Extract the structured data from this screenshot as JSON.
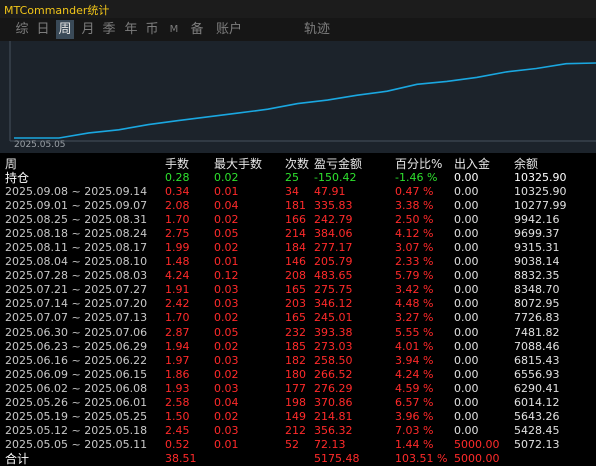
{
  "app": {
    "title": "MTCommander统计"
  },
  "tabs": [
    {
      "label": "综"
    },
    {
      "label": "日"
    },
    {
      "label": "周",
      "active": true
    },
    {
      "label": "月"
    },
    {
      "label": "季"
    },
    {
      "label": "年"
    },
    {
      "label": "币"
    },
    {
      "label": "M"
    },
    {
      "label": "备"
    },
    {
      "label": "账户"
    },
    {
      "label": "轨迹"
    }
  ],
  "chart": {
    "start_label": "2025.05.05",
    "line_color": "#1aa7e0",
    "background_color": "#1c232b"
  },
  "chart_data": {
    "type": "line",
    "title": "",
    "x_start_label": "2025.05.05",
    "x": [
      "2025.05.05",
      "2025.05.12",
      "2025.05.19",
      "2025.05.26",
      "2025.06.02",
      "2025.06.09",
      "2025.06.16",
      "2025.06.23",
      "2025.06.30",
      "2025.07.07",
      "2025.07.14",
      "2025.07.21",
      "2025.07.28",
      "2025.08.04",
      "2025.08.11",
      "2025.08.18",
      "2025.08.25",
      "2025.09.01",
      "2025.09.08"
    ],
    "series": [
      {
        "values": [
          5072.13,
          5428.45,
          5643.26,
          6014.12,
          6290.41,
          6556.93,
          6815.43,
          7088.46,
          7481.82,
          7726.83,
          8072.95,
          8348.7,
          8832.35,
          9038.14,
          9315.31,
          9699.37,
          9942.16,
          10277.99,
          10325.9
        ]
      }
    ]
  },
  "stats": {
    "header": {
      "period": "周",
      "lots": "手数",
      "max_lots": "最大手数",
      "count": "次数",
      "profit": "盈亏金额",
      "percent": "百分比%",
      "inout": "出入金",
      "balance": "余额"
    },
    "position": {
      "label": "持仓",
      "lots": "0.28",
      "max_lots": "0.02",
      "count": "25",
      "profit": "-150.42",
      "percent": "-1.46 %",
      "inout": "0.00",
      "balance": "10325.90"
    },
    "rows": [
      {
        "period": "2025.09.08 ~ 2025.09.14",
        "lots": "0.34",
        "max_lots": "0.01",
        "count": "34",
        "profit": "47.91",
        "percent": "0.47 %",
        "inout": "0.00",
        "balance": "10325.90"
      },
      {
        "period": "2025.09.01 ~ 2025.09.07",
        "lots": "2.08",
        "max_lots": "0.04",
        "count": "181",
        "profit": "335.83",
        "percent": "3.38 %",
        "inout": "0.00",
        "balance": "10277.99"
      },
      {
        "period": "2025.08.25 ~ 2025.08.31",
        "lots": "1.70",
        "max_lots": "0.02",
        "count": "166",
        "profit": "242.79",
        "percent": "2.50 %",
        "inout": "0.00",
        "balance": "9942.16"
      },
      {
        "period": "2025.08.18 ~ 2025.08.24",
        "lots": "2.75",
        "max_lots": "0.05",
        "count": "214",
        "profit": "384.06",
        "percent": "4.12 %",
        "inout": "0.00",
        "balance": "9699.37"
      },
      {
        "period": "2025.08.11 ~ 2025.08.17",
        "lots": "1.99",
        "max_lots": "0.02",
        "count": "184",
        "profit": "277.17",
        "percent": "3.07 %",
        "inout": "0.00",
        "balance": "9315.31"
      },
      {
        "period": "2025.08.04 ~ 2025.08.10",
        "lots": "1.48",
        "max_lots": "0.01",
        "count": "146",
        "profit": "205.79",
        "percent": "2.33 %",
        "inout": "0.00",
        "balance": "9038.14"
      },
      {
        "period": "2025.07.28 ~ 2025.08.03",
        "lots": "4.24",
        "max_lots": "0.12",
        "count": "208",
        "profit": "483.65",
        "percent": "5.79 %",
        "inout": "0.00",
        "balance": "8832.35"
      },
      {
        "period": "2025.07.21 ~ 2025.07.27",
        "lots": "1.91",
        "max_lots": "0.03",
        "count": "165",
        "profit": "275.75",
        "percent": "3.42 %",
        "inout": "0.00",
        "balance": "8348.70"
      },
      {
        "period": "2025.07.14 ~ 2025.07.20",
        "lots": "2.42",
        "max_lots": "0.03",
        "count": "203",
        "profit": "346.12",
        "percent": "4.48 %",
        "inout": "0.00",
        "balance": "8072.95"
      },
      {
        "period": "2025.07.07 ~ 2025.07.13",
        "lots": "1.70",
        "max_lots": "0.02",
        "count": "165",
        "profit": "245.01",
        "percent": "3.27 %",
        "inout": "0.00",
        "balance": "7726.83"
      },
      {
        "period": "2025.06.30 ~ 2025.07.06",
        "lots": "2.87",
        "max_lots": "0.05",
        "count": "232",
        "profit": "393.38",
        "percent": "5.55 %",
        "inout": "0.00",
        "balance": "7481.82"
      },
      {
        "period": "2025.06.23 ~ 2025.06.29",
        "lots": "1.94",
        "max_lots": "0.02",
        "count": "185",
        "profit": "273.03",
        "percent": "4.01 %",
        "inout": "0.00",
        "balance": "7088.46"
      },
      {
        "period": "2025.06.16 ~ 2025.06.22",
        "lots": "1.97",
        "max_lots": "0.03",
        "count": "182",
        "profit": "258.50",
        "percent": "3.94 %",
        "inout": "0.00",
        "balance": "6815.43"
      },
      {
        "period": "2025.06.09 ~ 2025.06.15",
        "lots": "1.86",
        "max_lots": "0.02",
        "count": "180",
        "profit": "266.52",
        "percent": "4.24 %",
        "inout": "0.00",
        "balance": "6556.93"
      },
      {
        "period": "2025.06.02 ~ 2025.06.08",
        "lots": "1.93",
        "max_lots": "0.03",
        "count": "177",
        "profit": "276.29",
        "percent": "4.59 %",
        "inout": "0.00",
        "balance": "6290.41"
      },
      {
        "period": "2025.05.26 ~ 2025.06.01",
        "lots": "2.58",
        "max_lots": "0.04",
        "count": "198",
        "profit": "370.86",
        "percent": "6.57 %",
        "inout": "0.00",
        "balance": "6014.12"
      },
      {
        "period": "2025.05.19 ~ 2025.05.25",
        "lots": "1.50",
        "max_lots": "0.02",
        "count": "149",
        "profit": "214.81",
        "percent": "3.96 %",
        "inout": "0.00",
        "balance": "5643.26"
      },
      {
        "period": "2025.05.12 ~ 2025.05.18",
        "lots": "2.45",
        "max_lots": "0.03",
        "count": "212",
        "profit": "356.32",
        "percent": "7.03 %",
        "inout": "0.00",
        "balance": "5428.45"
      },
      {
        "period": "2025.05.05 ~ 2025.05.11",
        "lots": "0.52",
        "max_lots": "0.01",
        "count": "52",
        "profit": "72.13",
        "percent": "1.44 %",
        "inout": "5000.00",
        "balance": "5072.13"
      }
    ],
    "total": {
      "label": "合计",
      "lots": "38.51",
      "profit": "5175.48",
      "percent": "103.51 %",
      "inout": "5000.00"
    }
  }
}
